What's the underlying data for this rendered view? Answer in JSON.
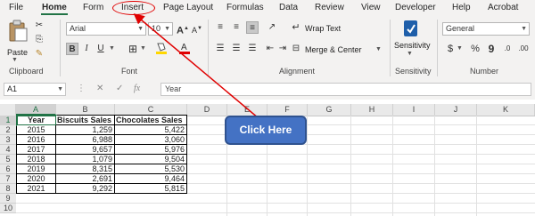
{
  "menu": {
    "items": [
      "File",
      "Home",
      "Form",
      "Insert",
      "Page Layout",
      "Formulas",
      "Data",
      "Review",
      "View",
      "Developer",
      "Help",
      "Acrobat"
    ]
  },
  "ribbon": {
    "clipboard": {
      "paste_label": "Paste",
      "group_label": "Clipboard"
    },
    "font": {
      "font_name": "Arial",
      "font_size": "10",
      "group_label": "Font"
    },
    "alignment": {
      "wrap_text": "Wrap Text",
      "merge_center": "Merge & Center",
      "group_label": "Alignment"
    },
    "sensitivity": {
      "label": "Sensitivity",
      "group_label": "Sensitivity"
    },
    "number": {
      "format": "General",
      "group_label": "Number"
    }
  },
  "formula_bar": {
    "name_box": "A1",
    "content": "Year"
  },
  "grid": {
    "columns": [
      "A",
      "B",
      "C",
      "D",
      "E",
      "F",
      "G",
      "H",
      "I",
      "J",
      "K"
    ],
    "rows": [
      "1",
      "2",
      "3",
      "4",
      "5",
      "6",
      "7",
      "8",
      "9",
      "10"
    ],
    "headers": [
      "Year",
      "Biscuits Sales",
      "Chocolates Sales"
    ],
    "data": [
      [
        "2015",
        "1,259",
        "5,422"
      ],
      [
        "2016",
        "6,988",
        "3,060"
      ],
      [
        "2017",
        "9,657",
        "5,976"
      ],
      [
        "2018",
        "1,079",
        "9,504"
      ],
      [
        "2019",
        "8,315",
        "5,530"
      ],
      [
        "2020",
        "2,691",
        "9,464"
      ],
      [
        "2021",
        "9,292",
        "5,815"
      ]
    ]
  },
  "callout": {
    "label": "Click Here"
  },
  "colors": {
    "accent": "#217346",
    "callout": "#4472c4",
    "annotation": "#e00000"
  }
}
